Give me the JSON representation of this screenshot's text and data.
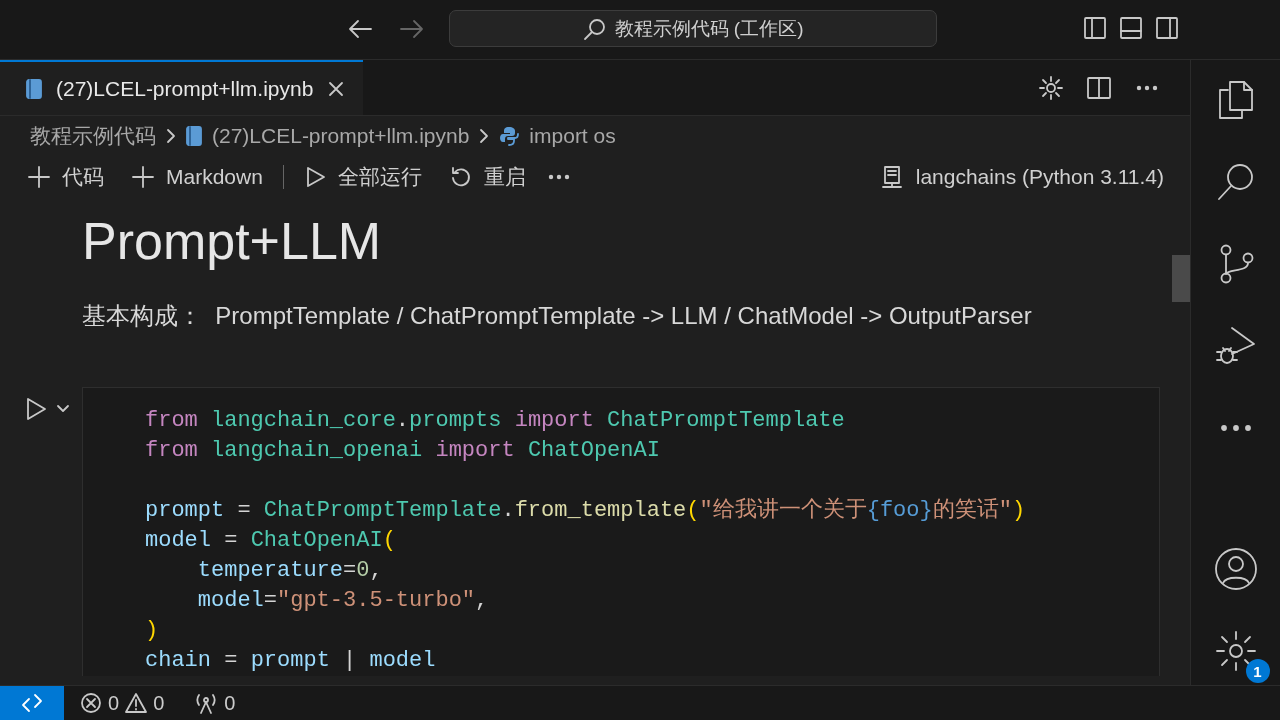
{
  "title_bar": {
    "search": "教程示例代码 (工作区)"
  },
  "tabs": [
    {
      "label": "(27)LCEL-prompt+llm.ipynb",
      "selected": true
    }
  ],
  "breadcrumb": [
    {
      "kind": "folder",
      "label": "教程示例代码"
    },
    {
      "kind": "notebook",
      "label": "(27)LCEL-prompt+llm.ipynb"
    },
    {
      "kind": "python",
      "label": "import os"
    }
  ],
  "toolbar": {
    "items": [
      {
        "kind": "add",
        "label": "代码"
      },
      {
        "kind": "add",
        "label": "Markdown"
      },
      {
        "kind": "run",
        "label": "全部运行"
      },
      {
        "kind": "restart",
        "label": "重启"
      }
    ],
    "kernel": "langchains (Python 3.11.4)"
  },
  "markdown": {
    "heading": "Prompt+LLM",
    "text": "基本构成：  PromptTemplate / ChatPromptTemplate -> LLM / ChatModel -> OutputParser"
  },
  "cell": {
    "lines": [
      {
        "kind": "code",
        "tokens": [
          {
            "kind": "keyword",
            "text": "from "
          },
          {
            "kind": "module",
            "text": "langchain_core"
          },
          {
            "kind": "plain",
            "text": "."
          },
          {
            "kind": "module",
            "text": "prompts "
          },
          {
            "kind": "keyword",
            "text": "import "
          },
          {
            "kind": "class",
            "text": "ChatPromptTemplate"
          }
        ]
      },
      {
        "kind": "code",
        "tokens": [
          {
            "kind": "keyword",
            "text": "from "
          },
          {
            "kind": "module",
            "text": "langchain_openai "
          },
          {
            "kind": "keyword",
            "text": "import "
          },
          {
            "kind": "class",
            "text": "ChatOpenAI"
          }
        ]
      },
      {
        "kind": "blank"
      },
      {
        "kind": "code",
        "tokens": [
          {
            "kind": "variable",
            "text": "prompt"
          },
          {
            "kind": "plain",
            "text": " = "
          },
          {
            "kind": "class",
            "text": "ChatPromptTemplate"
          },
          {
            "kind": "plain",
            "text": "."
          },
          {
            "kind": "function",
            "text": "from_template"
          },
          {
            "kind": "bracket",
            "text": "("
          },
          {
            "kind": "string",
            "text": "\"给我讲一个关于"
          },
          {
            "kind": "interpolation",
            "text": "{foo}"
          },
          {
            "kind": "string",
            "text": "的笑话\""
          },
          {
            "kind": "bracket",
            "text": ")"
          }
        ]
      },
      {
        "kind": "code",
        "tokens": [
          {
            "kind": "variable",
            "text": "model"
          },
          {
            "kind": "plain",
            "text": " = "
          },
          {
            "kind": "class",
            "text": "ChatOpenAI"
          },
          {
            "kind": "bracket",
            "text": "("
          }
        ]
      },
      {
        "kind": "code",
        "indented": true,
        "tokens": [
          {
            "kind": "variable",
            "text": "temperature"
          },
          {
            "kind": "plain",
            "text": "="
          },
          {
            "kind": "number",
            "text": "0"
          },
          {
            "kind": "plain",
            "text": ","
          }
        ]
      },
      {
        "kind": "code",
        "indented": true,
        "tokens": [
          {
            "kind": "variable",
            "text": "model"
          },
          {
            "kind": "plain",
            "text": "="
          },
          {
            "kind": "string",
            "text": "\"gpt-3.5-turbo\""
          },
          {
            "kind": "plain",
            "text": ","
          }
        ]
      },
      {
        "kind": "code",
        "tokens": [
          {
            "kind": "bracket",
            "text": ")"
          }
        ]
      },
      {
        "kind": "code",
        "tokens": [
          {
            "kind": "variable",
            "text": "chain"
          },
          {
            "kind": "plain",
            "text": " = "
          },
          {
            "kind": "variable",
            "text": "prompt"
          },
          {
            "kind": "plain",
            "text": " | "
          },
          {
            "kind": "variable",
            "text": "model"
          }
        ]
      }
    ]
  },
  "activity_bar": {
    "settings_badge": "1"
  },
  "status_bar": {
    "errors": "0",
    "warnings": "0",
    "ports": "0"
  }
}
